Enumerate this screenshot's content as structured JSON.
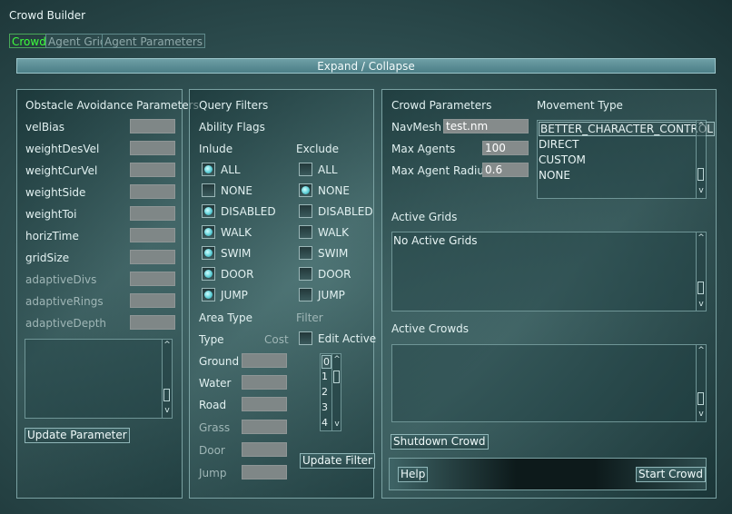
{
  "window": {
    "title": "Crowd Builder"
  },
  "tabs": [
    {
      "label": "Crowd"
    },
    {
      "label": "Agent Grid"
    },
    {
      "label": "Agent Parameters"
    }
  ],
  "expand_label": "Expand / Collapse",
  "obstacle": {
    "title": "Obstacle Avoidance Parameters",
    "params": [
      "velBias",
      "weightDesVel",
      "weightCurVel",
      "weightSide",
      "weightToi",
      "horizTime",
      "gridSize",
      "adaptiveDivs",
      "adaptiveRings",
      "adaptiveDepth"
    ],
    "update_button": "Update Parameter"
  },
  "query": {
    "title": "Query Filters",
    "ability_flags": "Ability Flags",
    "include_label": "Inlude",
    "exclude_label": "Exclude",
    "flags": [
      "ALL",
      "NONE",
      "DISABLED",
      "WALK",
      "SWIM",
      "DOOR",
      "JUMP"
    ],
    "area_type": "Area Type",
    "filter": "Filter",
    "type_label": "Type",
    "cost_label": "Cost",
    "edit_active": "Edit Active",
    "areas": [
      "Ground",
      "Water",
      "Road",
      "Grass",
      "Door",
      "Jump"
    ],
    "filter_list": [
      "0",
      "1",
      "2",
      "3",
      "4"
    ],
    "update_button": "Update Filter"
  },
  "crowd": {
    "title": "Crowd Parameters",
    "navmesh_label": "NavMesh",
    "navmesh_value": "test.nm",
    "max_agents_label": "Max Agents",
    "max_agents_value": "100",
    "max_radius_label": "Max Agent Radius",
    "max_radius_value": "0.6",
    "movement_title": "Movement Type",
    "movement_options": [
      "BETTER_CHARACTER_CONTROL",
      "DIRECT",
      "CUSTOM",
      "NONE"
    ],
    "active_grids_label": "Active Grids",
    "active_grids_empty": "No Active Grids",
    "active_crowds_label": "Active Crowds",
    "shutdown_button": "Shutdown Crowd",
    "help_button": "Help",
    "start_button": "Start Crowd"
  },
  "colors": {
    "active_tab": "#3cff3c",
    "checked": "#5fd0d8"
  }
}
